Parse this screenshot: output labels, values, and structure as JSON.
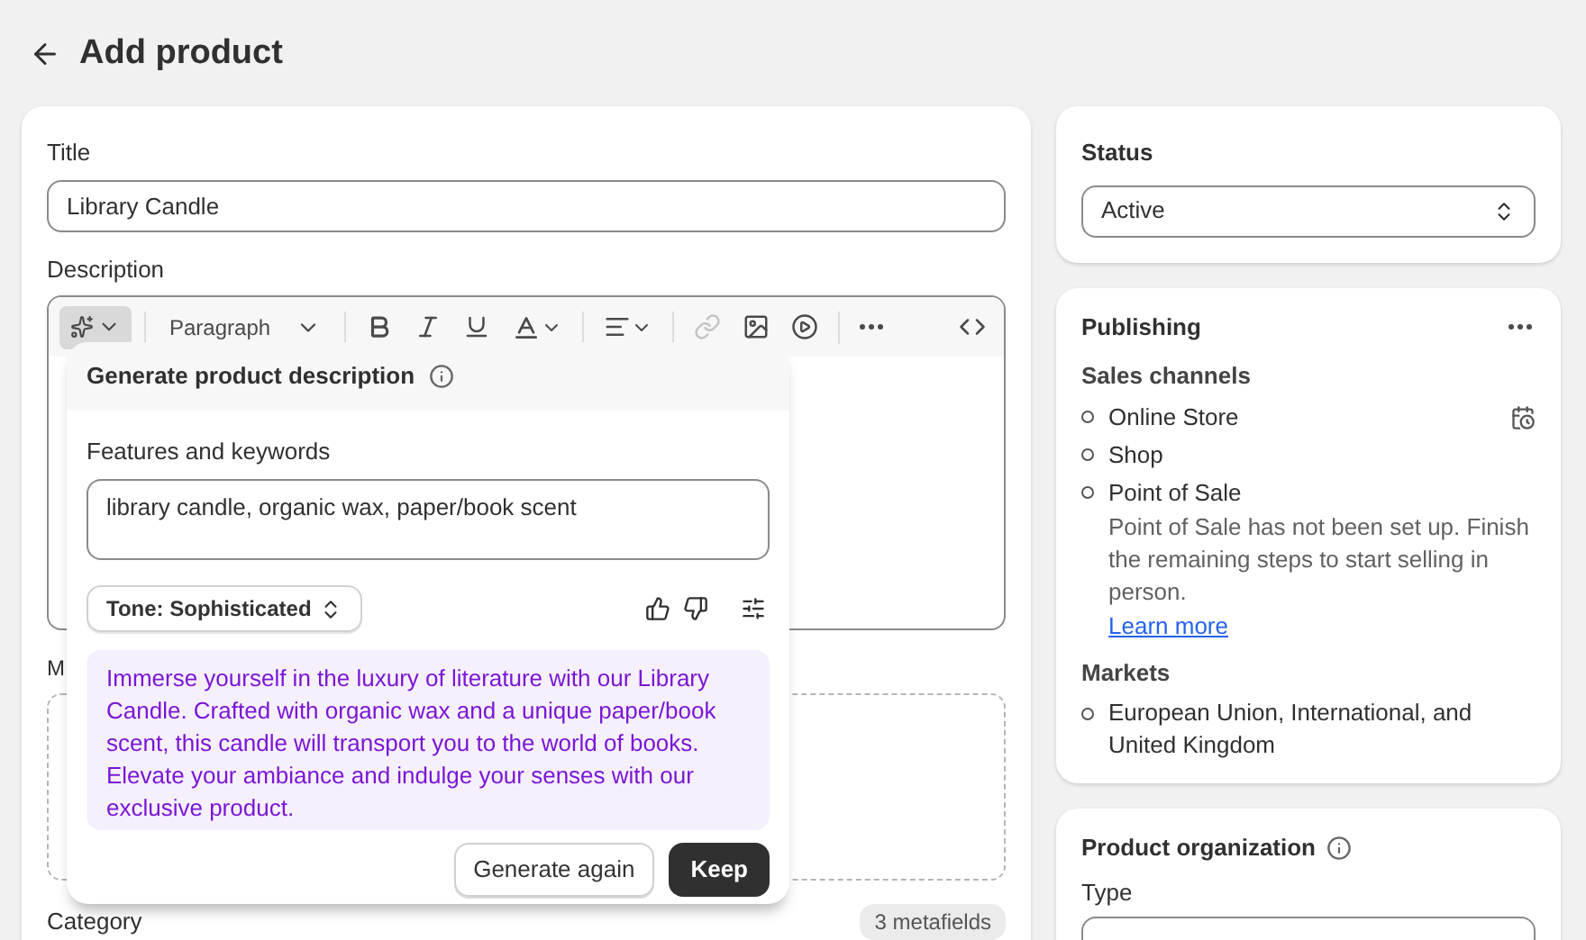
{
  "page": {
    "title": "Add product"
  },
  "title_field": {
    "label": "Title",
    "value": "Library Candle"
  },
  "description": {
    "label": "Description",
    "toolbar": {
      "paragraph": "Paragraph"
    }
  },
  "generator": {
    "title": "Generate product description",
    "keywords_label": "Features and keywords",
    "keywords": "library candle, organic wax, paper/book scent",
    "tone": "Tone: Sophisticated",
    "result": "Immerse yourself in the luxury of literature with our Library Candle. Crafted with organic wax and a unique paper/book scent, this candle will transport you to the world of books. Elevate your ambiance and indulge your senses with our exclusive product.",
    "buttons": [
      "Generate again",
      "Keep"
    ]
  },
  "media": {
    "label": "M"
  },
  "category": {
    "label": "Category",
    "badge": "3 metafields"
  },
  "status": {
    "title": "Status",
    "value": "Active"
  },
  "publishing": {
    "title": "Publishing",
    "channels_title": "Sales channels",
    "channels": [
      {
        "name": "Online Store"
      },
      {
        "name": "Shop"
      },
      {
        "name": "Point of Sale",
        "note": "Point of Sale has not been set up. Finish the remaining steps to start selling in person.",
        "link": "Learn more"
      }
    ],
    "markets_title": "Markets",
    "markets": [
      {
        "name": "European Union, International, and United Kingdom"
      }
    ]
  },
  "organization": {
    "title": "Product organization",
    "type_label": "Type"
  }
}
